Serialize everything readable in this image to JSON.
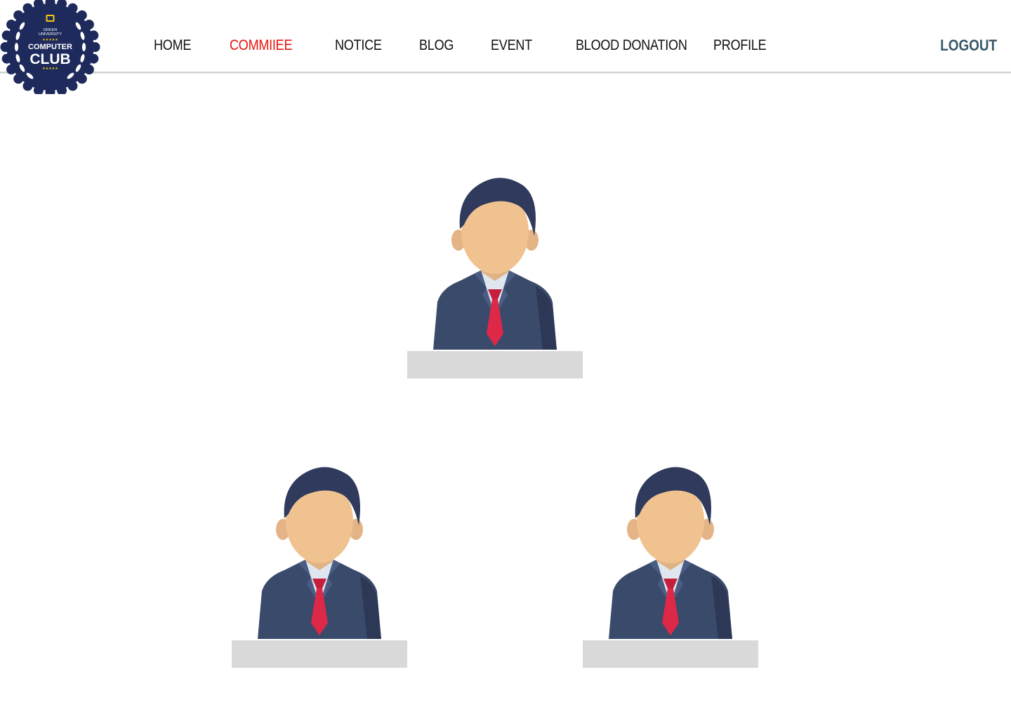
{
  "brand": {
    "logo_top_text": "GREEN UNIVERSITY",
    "logo_middle_text": "COMPUTER",
    "logo_bottom_text": "CLUB",
    "badge_color": "#1d2a5b",
    "accent_color": "#f2c80f"
  },
  "nav": {
    "items": [
      {
        "label": "HOME",
        "active": false
      },
      {
        "label": "COMMIIEE",
        "active": true
      },
      {
        "label": "NOTICE",
        "active": false
      },
      {
        "label": "BLOG",
        "active": false
      },
      {
        "label": "EVENT",
        "active": false
      },
      {
        "label": "BLOOD DONATION",
        "active": false
      },
      {
        "label": "PROFILE",
        "active": false
      }
    ],
    "logout_label": "LOGOUT",
    "active_color": "#e8120c",
    "logout_color": "#38586a"
  },
  "committee": {
    "members": [
      {
        "name": "",
        "avatar_icon": "businessman-avatar-icon"
      },
      {
        "name": "",
        "avatar_icon": "businessman-avatar-icon"
      },
      {
        "name": "",
        "avatar_icon": "businessman-avatar-icon"
      }
    ]
  }
}
